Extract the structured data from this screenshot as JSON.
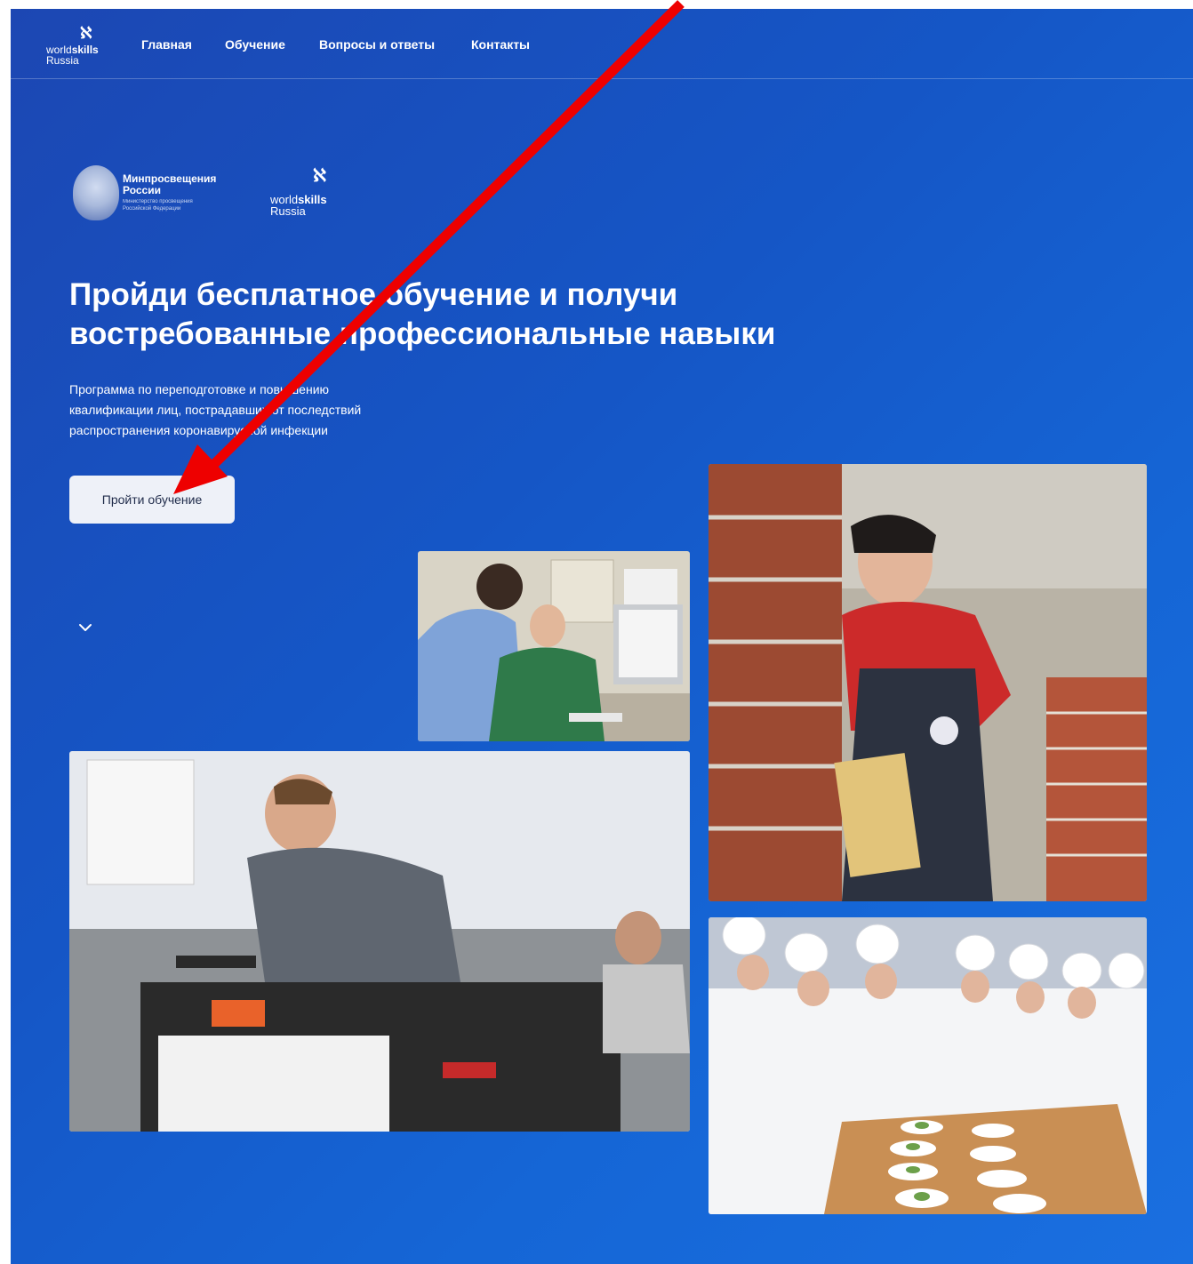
{
  "nav": {
    "logo": {
      "mark": "ℵ",
      "line1_regular": "world",
      "line1_bold": "skills",
      "line2": "Russia"
    },
    "items": [
      {
        "label": "Главная"
      },
      {
        "label": "Обучение"
      },
      {
        "label": "Вопросы и ответы"
      },
      {
        "label": "Контакты"
      }
    ]
  },
  "partners": {
    "ministry": {
      "name_line1": "Минпросвещения",
      "name_line2": "России",
      "caption_line1": "Министерство просвещения",
      "caption_line2": "Российской Федерации"
    },
    "worldskills": {
      "mark": "ℵ",
      "line1_regular": "world",
      "line1_bold": "skills",
      "line2": "Russia"
    }
  },
  "hero": {
    "title_line1": "Пройди бесплатное обучение и получи",
    "title_line2": "востребованные профессиональные навыки",
    "subtitle_line1": "Программа по переподготовке и повышению",
    "subtitle_line2": "квалификации лиц, пострадавших от последствий",
    "subtitle_line3": "распространения коронавирусной инфекции",
    "cta_label": "Пройти обучение"
  },
  "icons": {
    "scroll": "chevron-down-icon",
    "annotation": "red-arrow-icon"
  },
  "colors": {
    "background_start": "#1c47b3",
    "background_end": "#1a6fe0",
    "cta_background": "#eef1f8",
    "cta_text": "#1f2b4a",
    "annotation": "#ee0000"
  }
}
